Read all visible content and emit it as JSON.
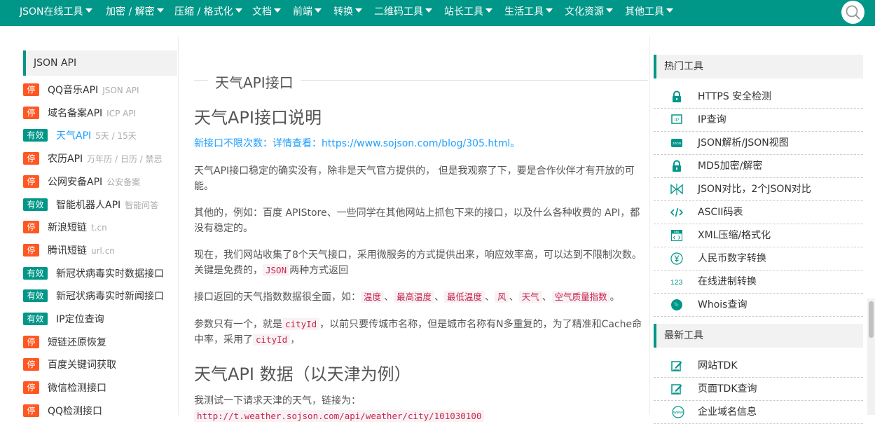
{
  "nav": {
    "items": [
      "JSON在线工具",
      "加密 / 解密",
      "压缩 / 格式化",
      "文档",
      "前端",
      "转换",
      "二维码工具",
      "站长工具",
      "生活工具",
      "文化资源",
      "其他工具"
    ]
  },
  "sidebar": {
    "header": "JSON API",
    "items": [
      {
        "status": "停",
        "name": "QQ音乐API",
        "sub": "JSON API"
      },
      {
        "status": "停",
        "name": "域名备案API",
        "sub": "ICP API"
      },
      {
        "status": "有效",
        "name": "天气API",
        "sub": "5天 / 15天"
      },
      {
        "status": "停",
        "name": "农历API",
        "sub": "万年历 / 日历 / 禁忌"
      },
      {
        "status": "停",
        "name": "公网安备API",
        "sub": "公安备案"
      },
      {
        "status": "有效",
        "name": "智能机器人API",
        "sub": "智能问答"
      },
      {
        "status": "停",
        "name": "新浪短链",
        "sub": "t.cn"
      },
      {
        "status": "停",
        "name": "腾讯短链",
        "sub": "url.cn"
      },
      {
        "status": "有效",
        "name": "新冠状病毒实时数据接口",
        "sub": ""
      },
      {
        "status": "有效",
        "name": "新冠状病毒实时新闻接口",
        "sub": ""
      },
      {
        "status": "有效",
        "name": "IP定位查询",
        "sub": ""
      },
      {
        "status": "停",
        "name": "短链还原恢复",
        "sub": ""
      },
      {
        "status": "停",
        "name": "百度关键词获取",
        "sub": ""
      },
      {
        "status": "停",
        "name": "微信检测接口",
        "sub": ""
      },
      {
        "status": "停",
        "name": "QQ检测接口",
        "sub": ""
      }
    ]
  },
  "main": {
    "fieldset_title": "天气API接口",
    "h_intro": "天气API接口说明",
    "notice_prefix": "新接口不限次数：详情查看：",
    "notice_link": "https://www.sojson.com/blog/305.html",
    "notice_suffix": "。",
    "p1": "天气API接口稳定的确实没有，除非是天气官方提供的， 但是我观察了下，要是合作伙伴才有开放的可能。",
    "p2": "其他的，例如：百度 APIStore、一些同学在其他网站上抓包下来的接口，以及什么各种收费的 API，都没有稳定的。",
    "p3": "现在，我们网站收集了8个天气接口，采用微服务的方式提供出来，响应效率高，可以达到不限制次数。关键是免费的，",
    "p3_code": "JSON",
    "p3_suffix": "两种方式返回",
    "p4_prefix": "接口返回的天气指数数据很全面，如：",
    "p4_codes": [
      "温度",
      "最高温度",
      "最低温度",
      "风",
      "天气",
      "空气质量指数"
    ],
    "p4_sep": "、",
    "p4_suffix": "。",
    "p5_prefix": "参数只有一个，就是",
    "p5_code": "cityId",
    "p5_mid": "，以前只要传城市名称，但是城市名称有N多重复的，为了精准和Cache命中率，采用了",
    "p5_code2": "cityId",
    "p5_suffix": "，",
    "h_data": "天气API 数据（以天津为例）",
    "p6_prefix": "我测试一下请求天津的天气，链接为：",
    "p6_code": "http://t.weather.sojson.com/api/weather/city/101030100"
  },
  "hot": {
    "header": "热门工具",
    "items": [
      {
        "name": "HTTPS 安全检测",
        "icon": "lock-icon"
      },
      {
        "name": "IP查询",
        "icon": "ip-icon"
      },
      {
        "name": "JSON解析/JSON视图",
        "icon": "json-icon"
      },
      {
        "name": "MD5加密/解密",
        "icon": "lock-icon"
      },
      {
        "name": "JSON对比，2个JSON对比",
        "icon": "compare-icon"
      },
      {
        "name": "ASCII码表",
        "icon": "code-icon"
      },
      {
        "name": "XML压缩/格式化",
        "icon": "xml-icon"
      },
      {
        "name": "人民币数字转换",
        "icon": "yen-icon"
      },
      {
        "name": "在线进制转换",
        "icon": "number-icon"
      },
      {
        "name": "Whois查询",
        "icon": "globe-icon"
      }
    ]
  },
  "latest": {
    "header": "最新工具",
    "items": [
      {
        "name": "网站TDK",
        "icon": "edit-icon"
      },
      {
        "name": "页面TDK查询",
        "icon": "edit-icon"
      },
      {
        "name": "企业域名信息",
        "icon": "www-icon"
      }
    ]
  },
  "icon_text": {
    "ip": "IP",
    "json": "JSON",
    "number": "123",
    "xml": "XML",
    "www": "www"
  }
}
